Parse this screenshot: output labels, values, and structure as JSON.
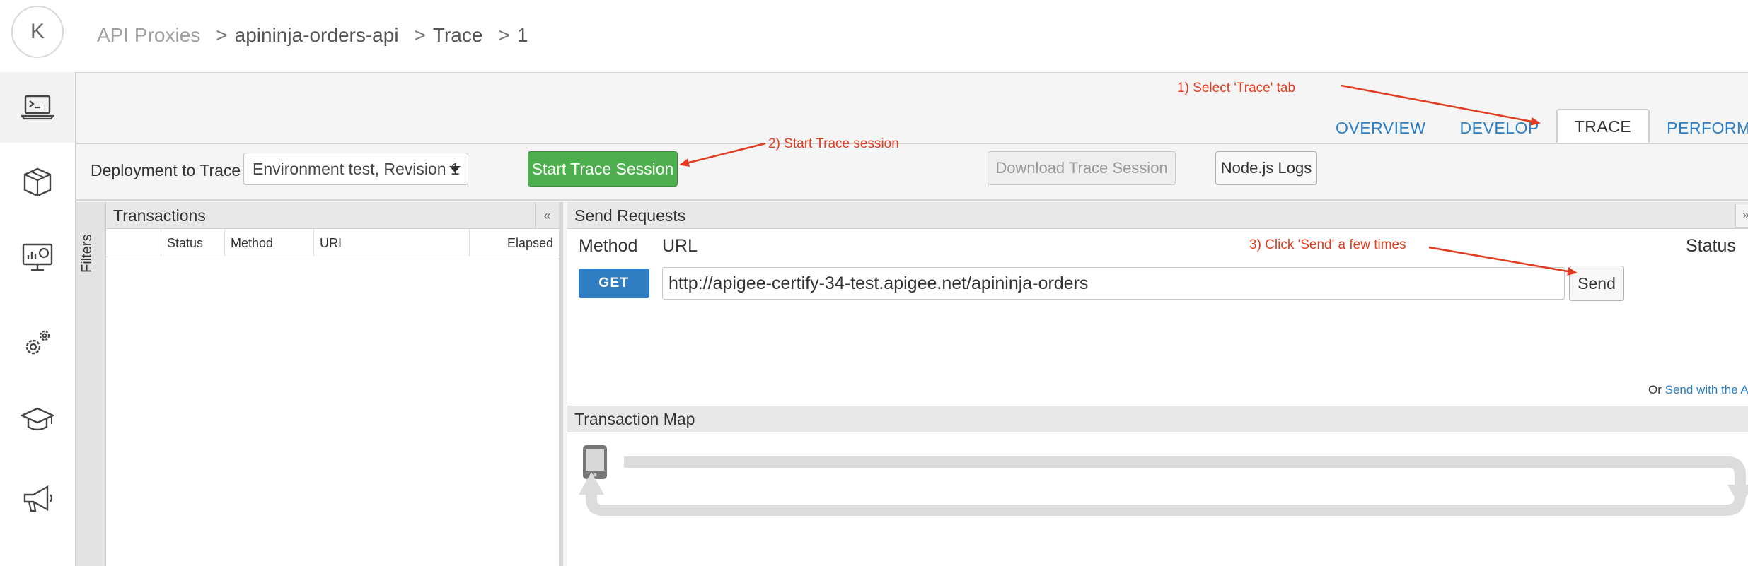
{
  "avatar": {
    "initial": "K"
  },
  "breadcrumb": {
    "root": "API Proxies",
    "items": [
      "apininja-orders-api",
      "Trace",
      "1"
    ],
    "separator": ">"
  },
  "sidebar": {
    "items": [
      {
        "name": "develop",
        "icon": "terminal-laptop-icon",
        "active": true
      },
      {
        "name": "publish",
        "icon": "package-box-icon"
      },
      {
        "name": "analyze",
        "icon": "dashboard-monitor-icon"
      },
      {
        "name": "admin",
        "icon": "settings-gears-icon"
      },
      {
        "name": "learn",
        "icon": "graduation-cap-icon"
      },
      {
        "name": "announcements",
        "icon": "megaphone-icon"
      }
    ]
  },
  "tabs": [
    {
      "label": "OVERVIEW",
      "active": false
    },
    {
      "label": "DEVELOP",
      "active": false
    },
    {
      "label": "TRACE",
      "active": true
    },
    {
      "label": "PERFORMANCE",
      "active": false
    }
  ],
  "toolbar": {
    "deployment_label": "Deployment to Trace",
    "deployment_value": "Environment test, Revision 1",
    "start_button": "Start Trace Session",
    "download_button": "Download Trace Session",
    "nodejs_button": "Node.js Logs"
  },
  "filters": {
    "label": "Filters"
  },
  "transactions": {
    "title": "Transactions",
    "collapse_glyph": "«",
    "columns": [
      "Status",
      "Method",
      "URI",
      "Elapsed"
    ]
  },
  "send_requests": {
    "title": "Send Requests",
    "collapse_glyph": "»",
    "method_label": "Method",
    "url_label": "URL",
    "status_label": "Status",
    "method_value": "GET",
    "url_value": "http://apigee-certify-34-test.apigee.net/apininja-orders",
    "send_button": "Send",
    "console_prefix": "Or",
    "console_link": "Send with the API Console"
  },
  "transaction_map": {
    "title": "Transaction Map",
    "device_icon": "mobile-phone-icon"
  },
  "annotations": {
    "step1": "1) Select 'Trace' tab",
    "step2": "2) Start Trace session",
    "step3": "3) Click 'Send' a few times",
    "color": "#e23b1f"
  },
  "colors": {
    "link_blue": "#2b7fc7",
    "green_button": "#4cae4c",
    "get_button": "#2f7dc2",
    "annotation_red": "#e23b1f"
  }
}
